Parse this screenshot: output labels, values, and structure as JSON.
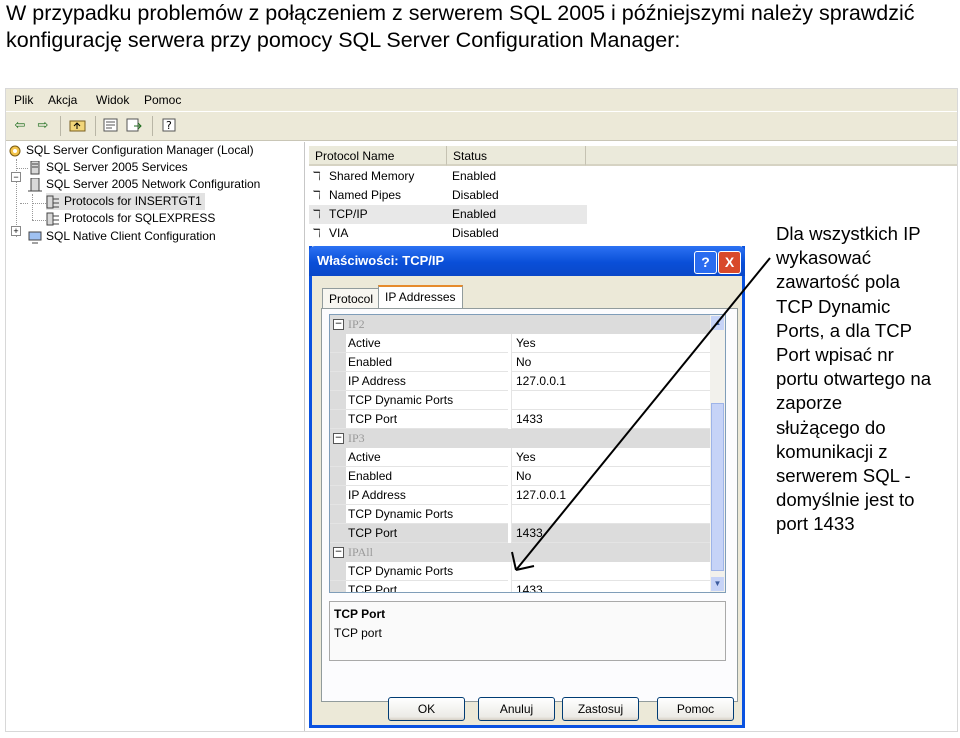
{
  "caption": "W przypadku problemów z połączeniem z serwerem SQL 2005 i późniejszymi należy sprawdzić konfigurację serwera przy pomocy SQL Server Configuration Manager:",
  "menu": [
    "Plik",
    "Akcja",
    "Widok",
    "Pomoc"
  ],
  "toolbar_icons": [
    "back-icon",
    "forward-icon",
    "up-folder-icon",
    "properties-icon",
    "export-icon",
    "help-icon"
  ],
  "tree": {
    "root": "SQL Server Configuration Manager (Local)",
    "services": "SQL Server 2005 Services",
    "network": "SQL Server 2005 Network Configuration",
    "prot1": "Protocols for INSERTGT1",
    "prot2": "Protocols for SQLEXPRESS",
    "native": "SQL Native Client Configuration"
  },
  "list": {
    "col1": "Protocol Name",
    "col2": "Status",
    "rows": [
      {
        "name": "Shared Memory",
        "status": "Enabled"
      },
      {
        "name": "Named Pipes",
        "status": "Disabled"
      },
      {
        "name": "TCP/IP",
        "status": "Enabled"
      },
      {
        "name": "VIA",
        "status": "Disabled"
      }
    ]
  },
  "dialog": {
    "title": "Właściwości: TCP/IP",
    "help": "?",
    "close": "X",
    "tabs": [
      "Protocol",
      "IP Addresses"
    ],
    "grid": {
      "ip2": {
        "cat": "IP2",
        "active_k": "Active",
        "active_v": "Yes",
        "enabled_k": "Enabled",
        "enabled_v": "No",
        "addr_k": "IP Address",
        "addr_v": "127.0.0.1",
        "dyn_k": "TCP Dynamic Ports",
        "dyn_v": "",
        "port_k": "TCP Port",
        "port_v": "1433"
      },
      "ip3": {
        "cat": "IP3",
        "active_k": "Active",
        "active_v": "Yes",
        "enabled_k": "Enabled",
        "enabled_v": "No",
        "addr_k": "IP Address",
        "addr_v": "127.0.0.1",
        "dyn_k": "TCP Dynamic Ports",
        "dyn_v": "",
        "port_k": "TCP Port",
        "port_v": "1433"
      },
      "ipall": {
        "cat": "IPAll",
        "dyn_k": "TCP Dynamic Ports",
        "dyn_v": "",
        "port_k": "TCP Port",
        "port_v": "1433"
      }
    },
    "desc_title": "TCP Port",
    "desc_text": "TCP port",
    "buttons": {
      "ok": "OK",
      "cancel": "Anuluj",
      "apply": "Zastosuj",
      "help": "Pomoc"
    }
  },
  "note_lines": [
    "Dla wszystkich IP",
    "wykasować",
    "zawartość pola",
    "TCP Dynamic",
    "Ports, a dla TCP",
    "Port wpisać nr",
    "portu otwartego na",
    "zaporze",
    "służącego do",
    "komunikacji z",
    "serwerem SQL -",
    "domyślnie jest to",
    "port 1433"
  ]
}
